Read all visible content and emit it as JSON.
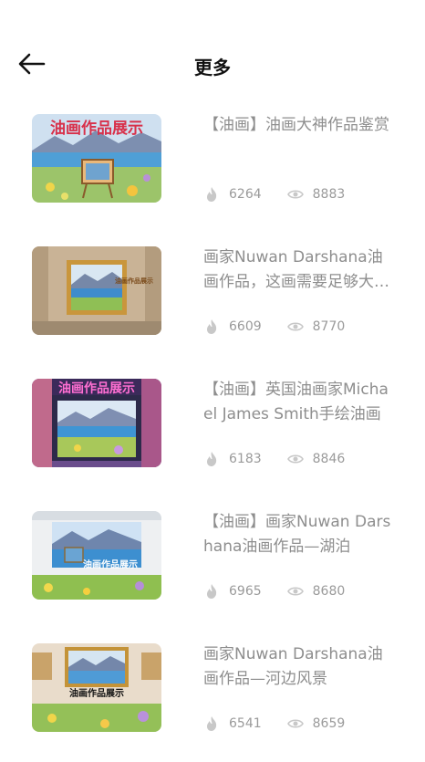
{
  "header": {
    "title": "更多",
    "back_icon": "arrow-left-icon"
  },
  "items": [
    {
      "title": "【油画】油画大神作品鉴赏",
      "likes": "6264",
      "views": "8883",
      "thumb_caption": "油画作品展示"
    },
    {
      "title": "画家Nuwan Darshana油画作品，这画需要足够大的空间",
      "likes": "6609",
      "views": "8770",
      "thumb_caption": "油画作品展示"
    },
    {
      "title": "【油画】英国油画家Michael James Smith手绘油画",
      "likes": "6183",
      "views": "8846",
      "thumb_caption": "油画作品展示"
    },
    {
      "title": "【油画】画家Nuwan Darshana油画作品—湖泊",
      "likes": "6965",
      "views": "8680",
      "thumb_caption": "油画作品展示"
    },
    {
      "title": "画家Nuwan Darshana油画作品—河边风景",
      "likes": "6541",
      "views": "8659",
      "thumb_caption": "油画作品展示"
    }
  ],
  "icons": {
    "likes": "flame-icon",
    "views": "eye-icon"
  },
  "colors": {
    "title_text": "#111111",
    "item_text": "#8e8e8e",
    "stat_text": "#9a9a9a",
    "icon": "#c8c8c8"
  }
}
